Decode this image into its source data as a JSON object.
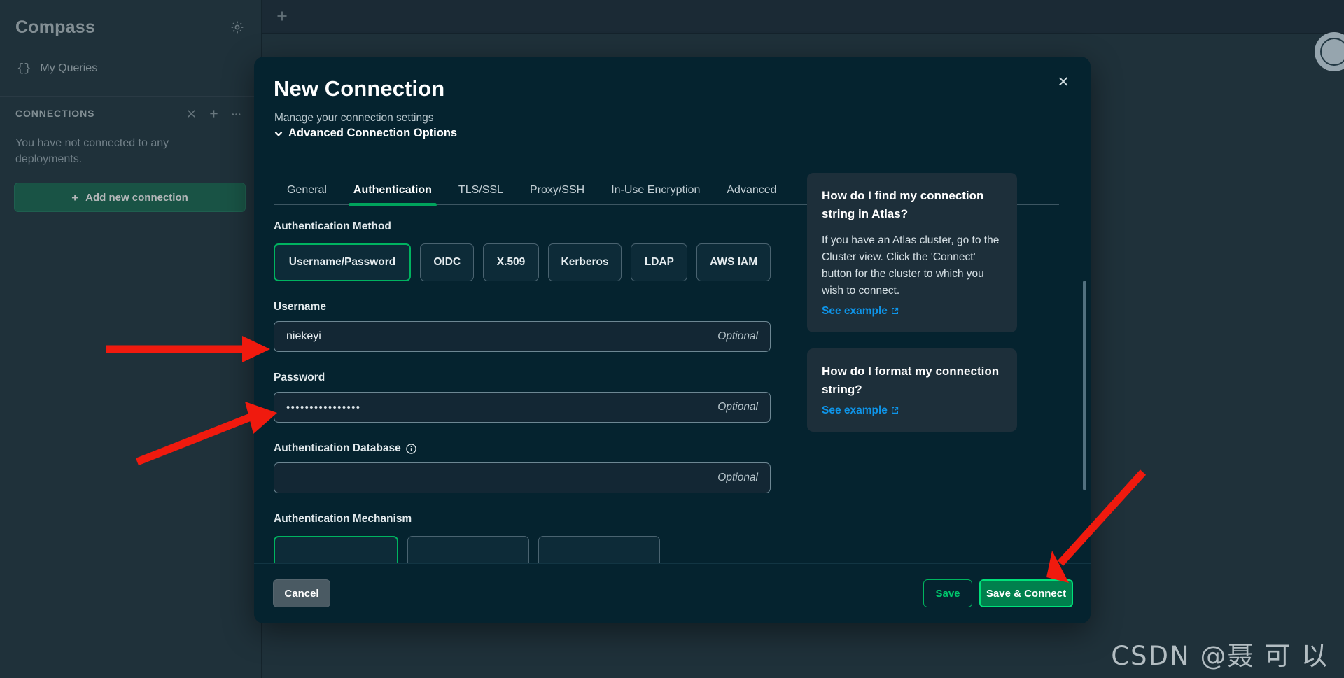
{
  "sidebar": {
    "logo": "Compass",
    "gear_icon": "gear-icon",
    "my_queries": "My Queries",
    "queries_icon": "braces-icon",
    "connections_title": "CONNECTIONS",
    "collapse_icon": "collapse-icon",
    "plus_icon": "plus-icon",
    "more_icon": "ellipsis-icon",
    "empty_text": "You have not connected to any deployments.",
    "add_button": "Add new connection",
    "add_plus": "+"
  },
  "topbar": {
    "new_tab_icon": "plus-icon"
  },
  "modal": {
    "title": "New Connection",
    "subtitle": "Manage your connection settings",
    "advanced_toggle": "Advanced Connection Options",
    "close_icon": "close-icon",
    "chevron_icon": "chevron-down-icon",
    "tabs": [
      {
        "label": "General",
        "active": false
      },
      {
        "label": "Authentication",
        "active": true
      },
      {
        "label": "TLS/SSL",
        "active": false
      },
      {
        "label": "Proxy/SSH",
        "active": false
      },
      {
        "label": "In-Use Encryption",
        "active": false
      },
      {
        "label": "Advanced",
        "active": false
      }
    ],
    "auth_method_label": "Authentication Method",
    "auth_methods": [
      {
        "label": "Username/Password",
        "selected": true
      },
      {
        "label": "OIDC",
        "selected": false
      },
      {
        "label": "X.509",
        "selected": false
      },
      {
        "label": "Kerberos",
        "selected": false
      },
      {
        "label": "LDAP",
        "selected": false
      },
      {
        "label": "AWS IAM",
        "selected": false
      }
    ],
    "username_label": "Username",
    "username_value": "niekeyi",
    "username_placeholder": "Optional",
    "password_label": "Password",
    "password_value": "••••••••••••••••",
    "password_placeholder": "Optional",
    "auth_db_label": "Authentication Database",
    "auth_db_info_icon": "info-icon",
    "auth_db_value": "",
    "auth_db_placeholder": "Optional",
    "auth_mechanism_label": "Authentication Mechanism",
    "help_cards": [
      {
        "heading": "How do I find my connection string in Atlas?",
        "body": "If you have an Atlas cluster, go to the Cluster view. Click the 'Connect' button for the cluster to which you wish to connect.",
        "link": "See example",
        "link_icon": "external-link-icon"
      },
      {
        "heading": "How do I format my connection string?",
        "body": "",
        "link": "See example",
        "link_icon": "external-link-icon"
      }
    ],
    "footer": {
      "cancel": "Cancel",
      "save": "Save",
      "save_connect": "Save & Connect"
    }
  },
  "colors": {
    "accent_green": "#00a35c",
    "link_blue": "#0e94e8",
    "annotation_red": "#f01a0e"
  },
  "watermark": "CSDN @聂 可 以"
}
